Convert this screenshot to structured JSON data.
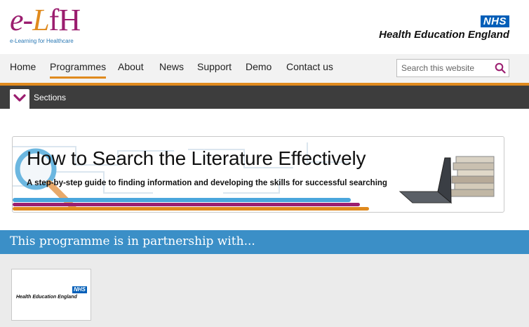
{
  "header": {
    "logo": {
      "text_e": "e-",
      "text_l": "L",
      "text_fh": "fH",
      "tagline": "e-Learning for Healthcare"
    },
    "partner_logo": {
      "nhs": "NHS",
      "name": "Health Education England"
    }
  },
  "nav": {
    "items": [
      {
        "label": "Home",
        "active": false
      },
      {
        "label": "Programmes",
        "active": true
      },
      {
        "label": "About",
        "active": false
      },
      {
        "label": "News",
        "active": false
      },
      {
        "label": "Support",
        "active": false
      },
      {
        "label": "Demo",
        "active": false
      },
      {
        "label": "Contact us",
        "active": false
      }
    ],
    "search": {
      "placeholder": "Search this website",
      "icon": "search-icon"
    }
  },
  "sections": {
    "label": "Sections",
    "icon": "chevron-down-icon"
  },
  "banner": {
    "title": "How to Search the Literature Effectively",
    "subtitle": "A step-by-step guide to finding information and developing the skills for successful searching"
  },
  "partnership": {
    "title": "This programme is in partnership with...",
    "partners": [
      {
        "nhs": "NHS",
        "name": "Health Education England"
      }
    ]
  },
  "colors": {
    "brand_purple": "#9b1d6f",
    "accent_orange": "#e08a1e",
    "nhs_blue": "#005eb8",
    "partner_bar": "#3b8fc7",
    "sections_bar": "#3d3d3d"
  }
}
